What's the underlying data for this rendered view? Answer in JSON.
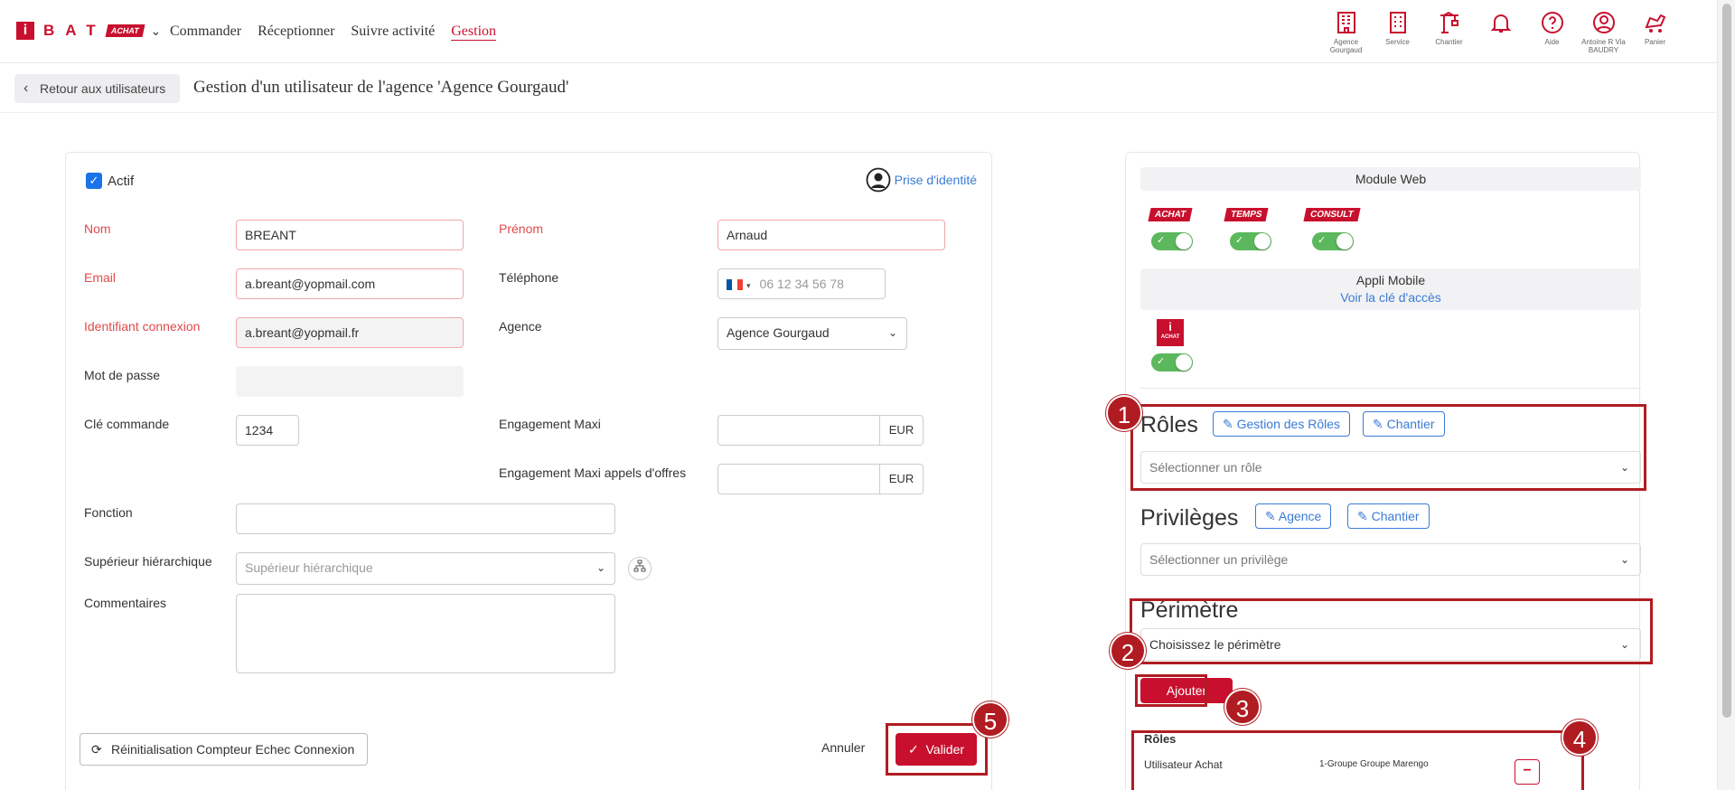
{
  "brand": {
    "i": "i",
    "letters": "BAT",
    "tag": "ACHAT"
  },
  "nav": {
    "items": [
      "Commander",
      "Réceptionner",
      "Suivre activité",
      "Gestion"
    ],
    "active": "Gestion"
  },
  "top_icons": [
    {
      "icon": "building-icon",
      "label": "Agence Gourgaud"
    },
    {
      "icon": "office-icon",
      "label": "Service"
    },
    {
      "icon": "crane-icon",
      "label": "Chantier"
    },
    {
      "icon": "bell-icon",
      "label": ""
    },
    {
      "icon": "help-icon",
      "label": "Aide"
    },
    {
      "icon": "user-icon",
      "label": "Antoine R Via BAUDRY"
    },
    {
      "icon": "cart-icon",
      "label": "Panier"
    }
  ],
  "header": {
    "back_label": "Retour aux utilisateurs",
    "title": "Gestion d'un utilisateur de l'agence 'Agence Gourgaud'"
  },
  "form": {
    "actif_label": "Actif",
    "prise_label": "Prise d'identité",
    "nom": {
      "label": "Nom",
      "value": "BREANT"
    },
    "prenom": {
      "label": "Prénom",
      "value": "Arnaud"
    },
    "email": {
      "label": "Email",
      "value": "a.breant@yopmail.com"
    },
    "telephone": {
      "label": "Téléphone",
      "placeholder": "06 12 34 56 78"
    },
    "identifiant": {
      "label": "Identifiant connexion",
      "value": "a.breant@yopmail.fr"
    },
    "agence": {
      "label": "Agence",
      "value": "Agence Gourgaud"
    },
    "mot_de_passe": {
      "label": "Mot de passe",
      "value": ""
    },
    "cle_commande": {
      "label": "Clé commande",
      "value": "1234"
    },
    "engagement": {
      "label": "Engagement Maxi",
      "value": "",
      "suffix": "EUR"
    },
    "engagement_ao": {
      "label": "Engagement Maxi appels d'offres",
      "value": "",
      "suffix": "EUR"
    },
    "fonction": {
      "label": "Fonction",
      "value": ""
    },
    "superieur": {
      "label": "Supérieur hiérarchique",
      "placeholder": "Supérieur hiérarchique"
    },
    "commentaires": {
      "label": "Commentaires",
      "value": ""
    },
    "reset_label": "Réinitialisation Compteur Echec Connexion",
    "annuler_label": "Annuler",
    "valider_label": "Valider"
  },
  "right": {
    "module_web": "Module Web",
    "modules": [
      "ACHAT",
      "TEMPS",
      "CONSULT"
    ],
    "appli_mobile": "Appli Mobile",
    "voir_cle": "Voir la clé d'accès",
    "mobile_app": {
      "i": "i",
      "label": "ACHAT"
    },
    "roles": {
      "title": "Rôles",
      "btn1": "Gestion des Rôles",
      "btn2": "Chantier",
      "placeholder": "Sélectionner un rôle"
    },
    "privileges": {
      "title": "Privilèges",
      "btn1": "Agence",
      "btn2": "Chantier",
      "placeholder": "Sélectionner un privilège"
    },
    "perimetre": {
      "title": "Périmètre",
      "placeholder": "Choisissez le périmètre"
    },
    "ajouter_label": "Ajouter",
    "table": {
      "header": "Rôles",
      "rows": [
        {
          "role": "Utilisateur Achat",
          "scope": "1-Groupe Groupe Marengo"
        }
      ]
    }
  },
  "annotations": [
    "1",
    "2",
    "3",
    "4",
    "5"
  ],
  "colors": {
    "brand": "#c8102e",
    "link": "#3a7bd5",
    "toggle_on": "#5cb85c",
    "annotation": "#b01c22"
  }
}
